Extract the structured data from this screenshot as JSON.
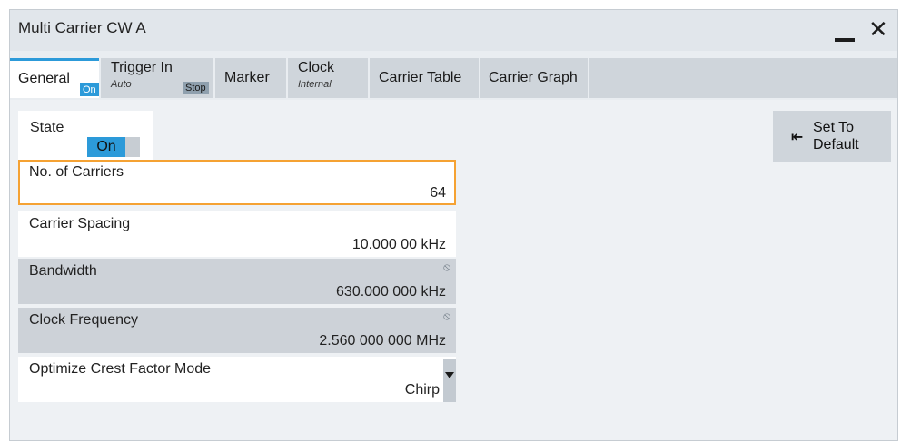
{
  "window": {
    "title": "Multi Carrier CW A"
  },
  "tabs": [
    {
      "label": "General",
      "badge": "On"
    },
    {
      "label": "Trigger In",
      "sub": "Auto",
      "badge": "Stop"
    },
    {
      "label": "Marker"
    },
    {
      "label": "Clock",
      "sub": "Internal"
    },
    {
      "label": "Carrier Table"
    },
    {
      "label": "Carrier Graph"
    }
  ],
  "state": {
    "label": "State",
    "value": "On"
  },
  "set_default": {
    "line1": "Set To",
    "line2": "Default",
    "icon": "arrow-to-left-icon"
  },
  "fields": {
    "num_carriers": {
      "label": "No. of Carriers",
      "value": "64"
    },
    "carrier_spacing": {
      "label": "Carrier Spacing",
      "value": "10.000 00 kHz"
    },
    "bandwidth": {
      "label": "Bandwidth",
      "value": "630.000 000 kHz"
    },
    "clock_frequency": {
      "label": "Clock Frequency",
      "value": "2.560 000 000 MHz"
    },
    "crest_factor_mode": {
      "label": "Optimize Crest Factor Mode",
      "value": "Chirp"
    }
  },
  "colors": {
    "accent": "#2c9ad9",
    "focus": "#f5a233"
  }
}
